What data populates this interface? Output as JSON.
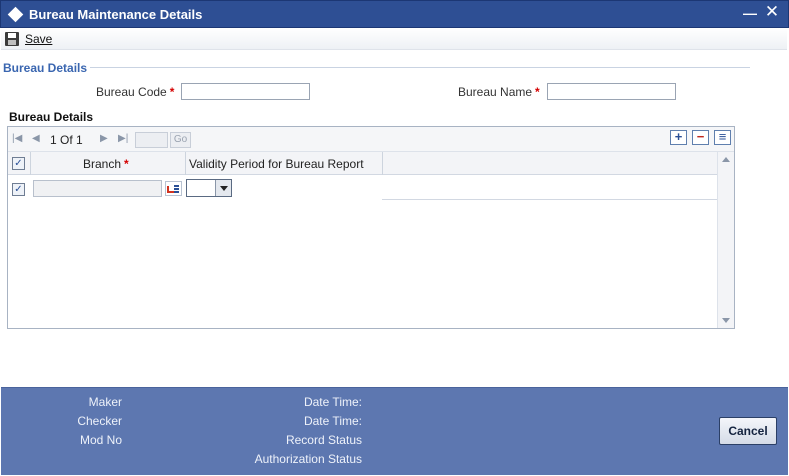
{
  "window": {
    "title": "Bureau Maintenance Details",
    "minimize_glyph": "—",
    "close_glyph": "✕"
  },
  "toolbar": {
    "save_label": "Save",
    "save_icon": "floppy-disk-icon"
  },
  "bureau_details": {
    "legend": "Bureau Details",
    "bureau_code": {
      "label": "Bureau Code",
      "required_mark": "*",
      "value": ""
    },
    "bureau_name": {
      "label": "Bureau Name",
      "required_mark": "*",
      "value": ""
    }
  },
  "grid": {
    "heading": "Bureau Details",
    "pager": {
      "page_text": "1 Of 1",
      "page_input": "",
      "go_label": "Go"
    },
    "tools": {
      "add": "+",
      "remove": "−",
      "view": "≡"
    },
    "columns": [
      {
        "label": "Branch",
        "required_mark": "*"
      },
      {
        "label": "Validity Period for Bureau Report",
        "required_mark": ""
      }
    ],
    "rows": [
      {
        "checked": true,
        "branch": "",
        "validity_period": ""
      }
    ],
    "header_checked": true
  },
  "footer": {
    "maker_label": "Maker",
    "checker_label": "Checker",
    "mod_no_label": "Mod No",
    "date_time_label_1": "Date Time:",
    "date_time_label_2": "Date Time:",
    "record_status_label": "Record Status",
    "authorization_status_label": "Authorization Status",
    "cancel_label": "Cancel"
  },
  "colors": {
    "title_bar": "#2e4f94",
    "footer_bar": "#5d77b0",
    "section_legend": "#3a66b0",
    "required": "#d40000"
  }
}
